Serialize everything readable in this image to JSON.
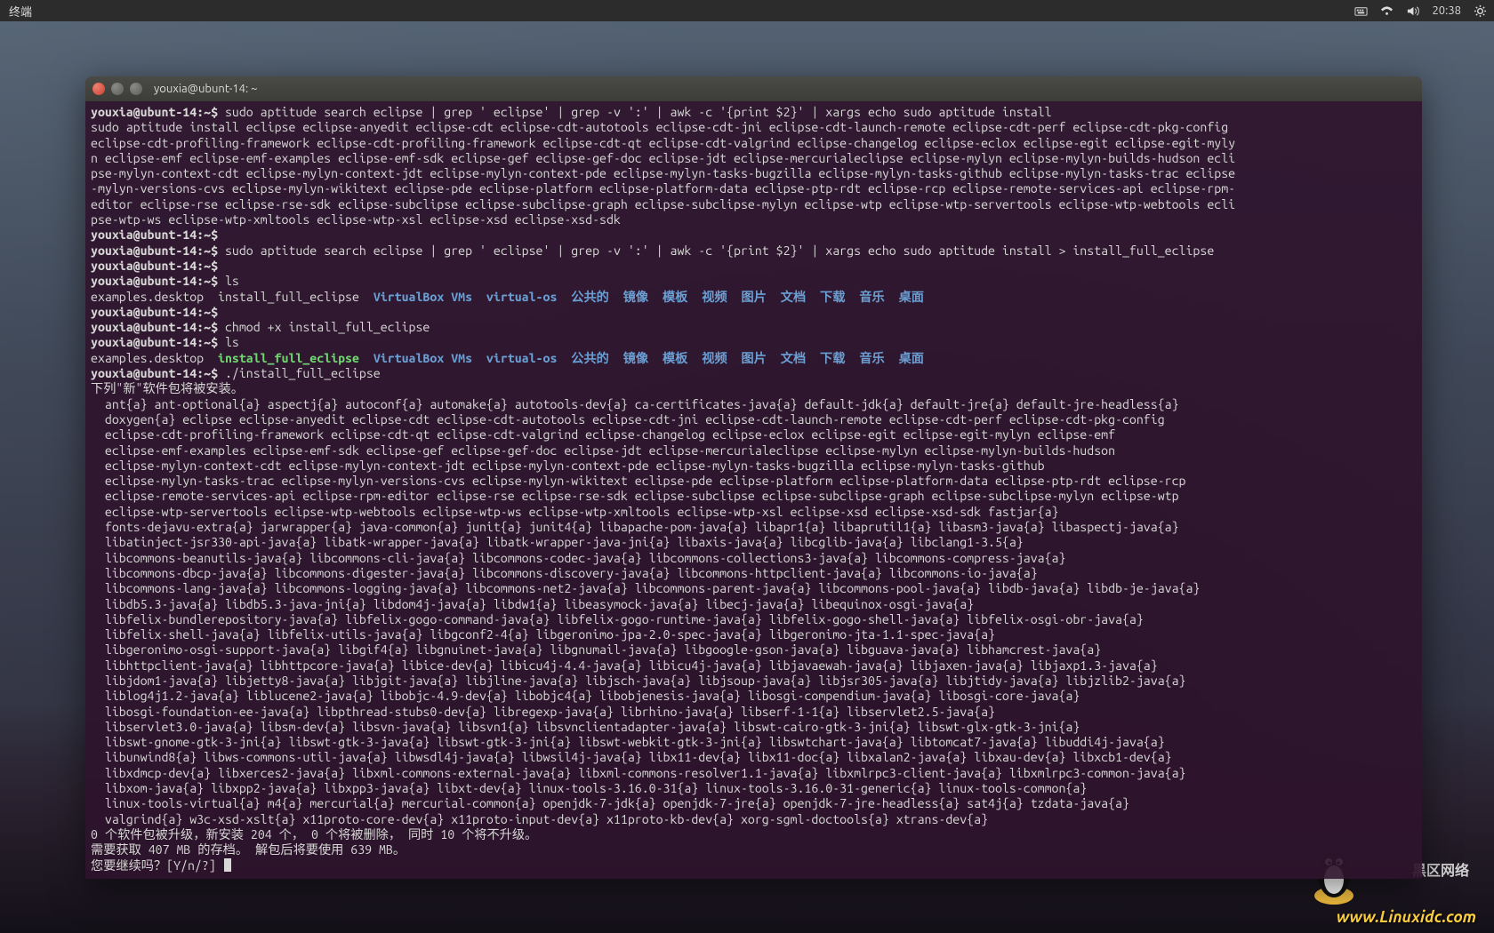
{
  "topbar": {
    "menu_label": "终端",
    "clock": "20:38"
  },
  "window": {
    "title": "youxia@ubunt-14: ~"
  },
  "term": {
    "prompt": "youxia@ubunt-14:~$",
    "cmd1": " sudo aptitude search eclipse | grep ' eclipse' | grep -v ':' | awk -c '{print $2}' | xargs echo sudo aptitude install",
    "out1a": "sudo aptitude install eclipse eclipse-anyedit eclipse-cdt eclipse-cdt-autotools eclipse-cdt-jni eclipse-cdt-launch-remote eclipse-cdt-perf eclipse-cdt-pkg-config",
    "out1b": "eclipse-cdt-profiling-framework eclipse-cdt-profiling-framework eclipse-cdt-qt eclipse-cdt-valgrind eclipse-changelog eclipse-eclox eclipse-egit eclipse-egit-myly",
    "out1c": "n eclipse-emf eclipse-emf-examples eclipse-emf-sdk eclipse-gef eclipse-gef-doc eclipse-jdt eclipse-mercurialeclipse eclipse-mylyn eclipse-mylyn-builds-hudson ecli",
    "out1d": "pse-mylyn-context-cdt eclipse-mylyn-context-jdt eclipse-mylyn-context-pde eclipse-mylyn-tasks-bugzilla eclipse-mylyn-tasks-github eclipse-mylyn-tasks-trac eclipse",
    "out1e": "-mylyn-versions-cvs eclipse-mylyn-wikitext eclipse-pde eclipse-platform eclipse-platform-data eclipse-ptp-rdt eclipse-rcp eclipse-remote-services-api eclipse-rpm-",
    "out1f": "editor eclipse-rse eclipse-rse-sdk eclipse-subclipse eclipse-subclipse-graph eclipse-subclipse-mylyn eclipse-wtp eclipse-wtp-servertools eclipse-wtp-webtools ecli",
    "out1g": "pse-wtp-ws eclipse-wtp-xmltools eclipse-wtp-xsl eclipse-xsd eclipse-xsd-sdk",
    "cmd2": " sudo aptitude search eclipse | grep ' eclipse' | grep -v ':' | awk -c '{print $2}' | xargs echo sudo aptitude install > install_full_eclipse",
    "cmd3": " ls",
    "ls1_plain1": "examples.desktop  install_full_eclipse  ",
    "ls1_dir": "VirtualBox VMs  virtual-os  公共的  镜像  模板  视频  图片  文档  下载  音乐  桌面",
    "cmd4": " chmod +x install_full_eclipse",
    "cmd5": " ls",
    "ls2_plain1": "examples.desktop  ",
    "ls2_exec": "install_full_eclipse",
    "ls2_gap": "  ",
    "ls2_dir": "VirtualBox VMs  virtual-os  公共的  镜像  模板  视频  图片  文档  下载  音乐  桌面",
    "cmd6": " ./install_full_eclipse",
    "inst_hdr": "下列\"新\"软件包将被安装。",
    "inst_lines": [
      "  ant{a} ant-optional{a} aspectj{a} autoconf{a} automake{a} autotools-dev{a} ca-certificates-java{a} default-jdk{a} default-jre{a} default-jre-headless{a}",
      "  doxygen{a} eclipse eclipse-anyedit eclipse-cdt eclipse-cdt-autotools eclipse-cdt-jni eclipse-cdt-launch-remote eclipse-cdt-perf eclipse-cdt-pkg-config",
      "  eclipse-cdt-profiling-framework eclipse-cdt-qt eclipse-cdt-valgrind eclipse-changelog eclipse-eclox eclipse-egit eclipse-egit-mylyn eclipse-emf",
      "  eclipse-emf-examples eclipse-emf-sdk eclipse-gef eclipse-gef-doc eclipse-jdt eclipse-mercurialeclipse eclipse-mylyn eclipse-mylyn-builds-hudson",
      "  eclipse-mylyn-context-cdt eclipse-mylyn-context-jdt eclipse-mylyn-context-pde eclipse-mylyn-tasks-bugzilla eclipse-mylyn-tasks-github",
      "  eclipse-mylyn-tasks-trac eclipse-mylyn-versions-cvs eclipse-mylyn-wikitext eclipse-pde eclipse-platform eclipse-platform-data eclipse-ptp-rdt eclipse-rcp",
      "  eclipse-remote-services-api eclipse-rpm-editor eclipse-rse eclipse-rse-sdk eclipse-subclipse eclipse-subclipse-graph eclipse-subclipse-mylyn eclipse-wtp",
      "  eclipse-wtp-servertools eclipse-wtp-webtools eclipse-wtp-ws eclipse-wtp-xmltools eclipse-wtp-xsl eclipse-xsd eclipse-xsd-sdk fastjar{a}",
      "  fonts-dejavu-extra{a} jarwrapper{a} java-common{a} junit{a} junit4{a} libapache-pom-java{a} libapr1{a} libaprutil1{a} libasm3-java{a} libaspectj-java{a}",
      "  libatinject-jsr330-api-java{a} libatk-wrapper-java{a} libatk-wrapper-java-jni{a} libaxis-java{a} libcglib-java{a} libclang1-3.5{a}",
      "  libcommons-beanutils-java{a} libcommons-cli-java{a} libcommons-codec-java{a} libcommons-collections3-java{a} libcommons-compress-java{a}",
      "  libcommons-dbcp-java{a} libcommons-digester-java{a} libcommons-discovery-java{a} libcommons-httpclient-java{a} libcommons-io-java{a}",
      "  libcommons-lang-java{a} libcommons-logging-java{a} libcommons-net2-java{a} libcommons-parent-java{a} libcommons-pool-java{a} libdb-java{a} libdb-je-java{a}",
      "  libdb5.3-java{a} libdb5.3-java-jni{a} libdom4j-java{a} libdw1{a} libeasymock-java{a} libecj-java{a} libequinox-osgi-java{a}",
      "  libfelix-bundlerepository-java{a} libfelix-gogo-command-java{a} libfelix-gogo-runtime-java{a} libfelix-gogo-shell-java{a} libfelix-osgi-obr-java{a}",
      "  libfelix-shell-java{a} libfelix-utils-java{a} libgconf2-4{a} libgeronimo-jpa-2.0-spec-java{a} libgeronimo-jta-1.1-spec-java{a}",
      "  libgeronimo-osgi-support-java{a} libgif4{a} libgnuinet-java{a} libgnumail-java{a} libgoogle-gson-java{a} libguava-java{a} libhamcrest-java{a}",
      "  libhttpclient-java{a} libhttpcore-java{a} libice-dev{a} libicu4j-4.4-java{a} libicu4j-java{a} libjavaewah-java{a} libjaxen-java{a} libjaxp1.3-java{a}",
      "  libjdom1-java{a} libjetty8-java{a} libjgit-java{a} libjline-java{a} libjsch-java{a} libjsoup-java{a} libjsr305-java{a} libjtidy-java{a} libjzlib2-java{a}",
      "  liblog4j1.2-java{a} liblucene2-java{a} libobjc-4.9-dev{a} libobjc4{a} libobjenesis-java{a} libosgi-compendium-java{a} libosgi-core-java{a}",
      "  libosgi-foundation-ee-java{a} libpthread-stubs0-dev{a} libregexp-java{a} librhino-java{a} libserf-1-1{a} libservlet2.5-java{a}",
      "  libservlet3.0-java{a} libsm-dev{a} libsvn-java{a} libsvn1{a} libsvnclientadapter-java{a} libswt-cairo-gtk-3-jni{a} libswt-glx-gtk-3-jni{a}",
      "  libswt-gnome-gtk-3-jni{a} libswt-gtk-3-java{a} libswt-gtk-3-jni{a} libswt-webkit-gtk-3-jni{a} libswtchart-java{a} libtomcat7-java{a} libuddi4j-java{a}",
      "  libunwind8{a} libws-commons-util-java{a} libwsdl4j-java{a} libwsil4j-java{a} libx11-dev{a} libx11-doc{a} libxalan2-java{a} libxau-dev{a} libxcb1-dev{a}",
      "  libxdmcp-dev{a} libxerces2-java{a} libxml-commons-external-java{a} libxml-commons-resolver1.1-java{a} libxmlrpc3-client-java{a} libxmlrpc3-common-java{a}",
      "  libxom-java{a} libxpp2-java{a} libxpp3-java{a} libxt-dev{a} linux-tools-3.16.0-31{a} linux-tools-3.16.0-31-generic{a} linux-tools-common{a}",
      "  linux-tools-virtual{a} m4{a} mercurial{a} mercurial-common{a} openjdk-7-jdk{a} openjdk-7-jre{a} openjdk-7-jre-headless{a} sat4j{a} tzdata-java{a}",
      "  valgrind{a} w3c-xsd-xslt{a} x11proto-core-dev{a} x11proto-input-dev{a} x11proto-kb-dev{a} xorg-sgml-doctools{a} xtrans-dev{a}"
    ],
    "summary1": "0 个软件包被升级，新安装 204 个， 0 个将被删除， 同时 10 个将不升级。",
    "summary2": "需要获取 407 MB 的存档。 解包后将要使用 639 MB。",
    "prompt_q": "您要继续吗？[Y/n/?] "
  },
  "watermark": {
    "brand": "黑区网络",
    "url": "www.Linuxidc.com"
  }
}
